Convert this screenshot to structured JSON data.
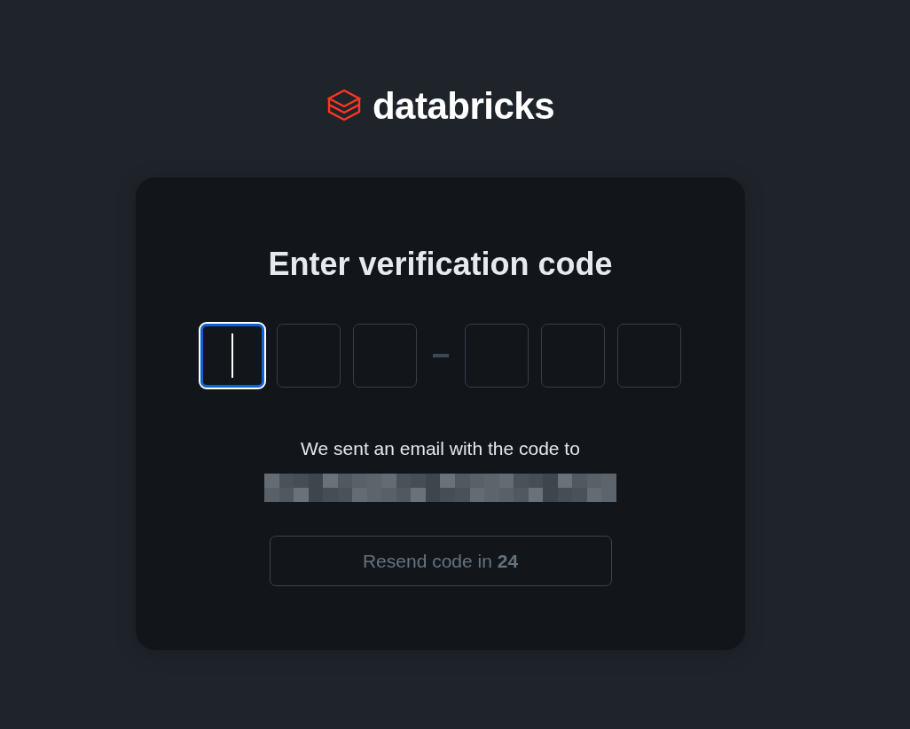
{
  "logo": {
    "wordmark": "databricks"
  },
  "card": {
    "title": "Enter verification code",
    "code_groups": [
      {
        "digits": [
          {
            "focused": true
          },
          {
            "focused": false
          },
          {
            "focused": false
          }
        ]
      },
      {
        "digits": [
          {
            "focused": false
          },
          {
            "focused": false
          },
          {
            "focused": false
          }
        ]
      }
    ],
    "message": "We sent an email with the code to",
    "recipient_redacted": true,
    "resend_button": {
      "label": "Resend code in **24**",
      "disabled": true
    }
  }
}
